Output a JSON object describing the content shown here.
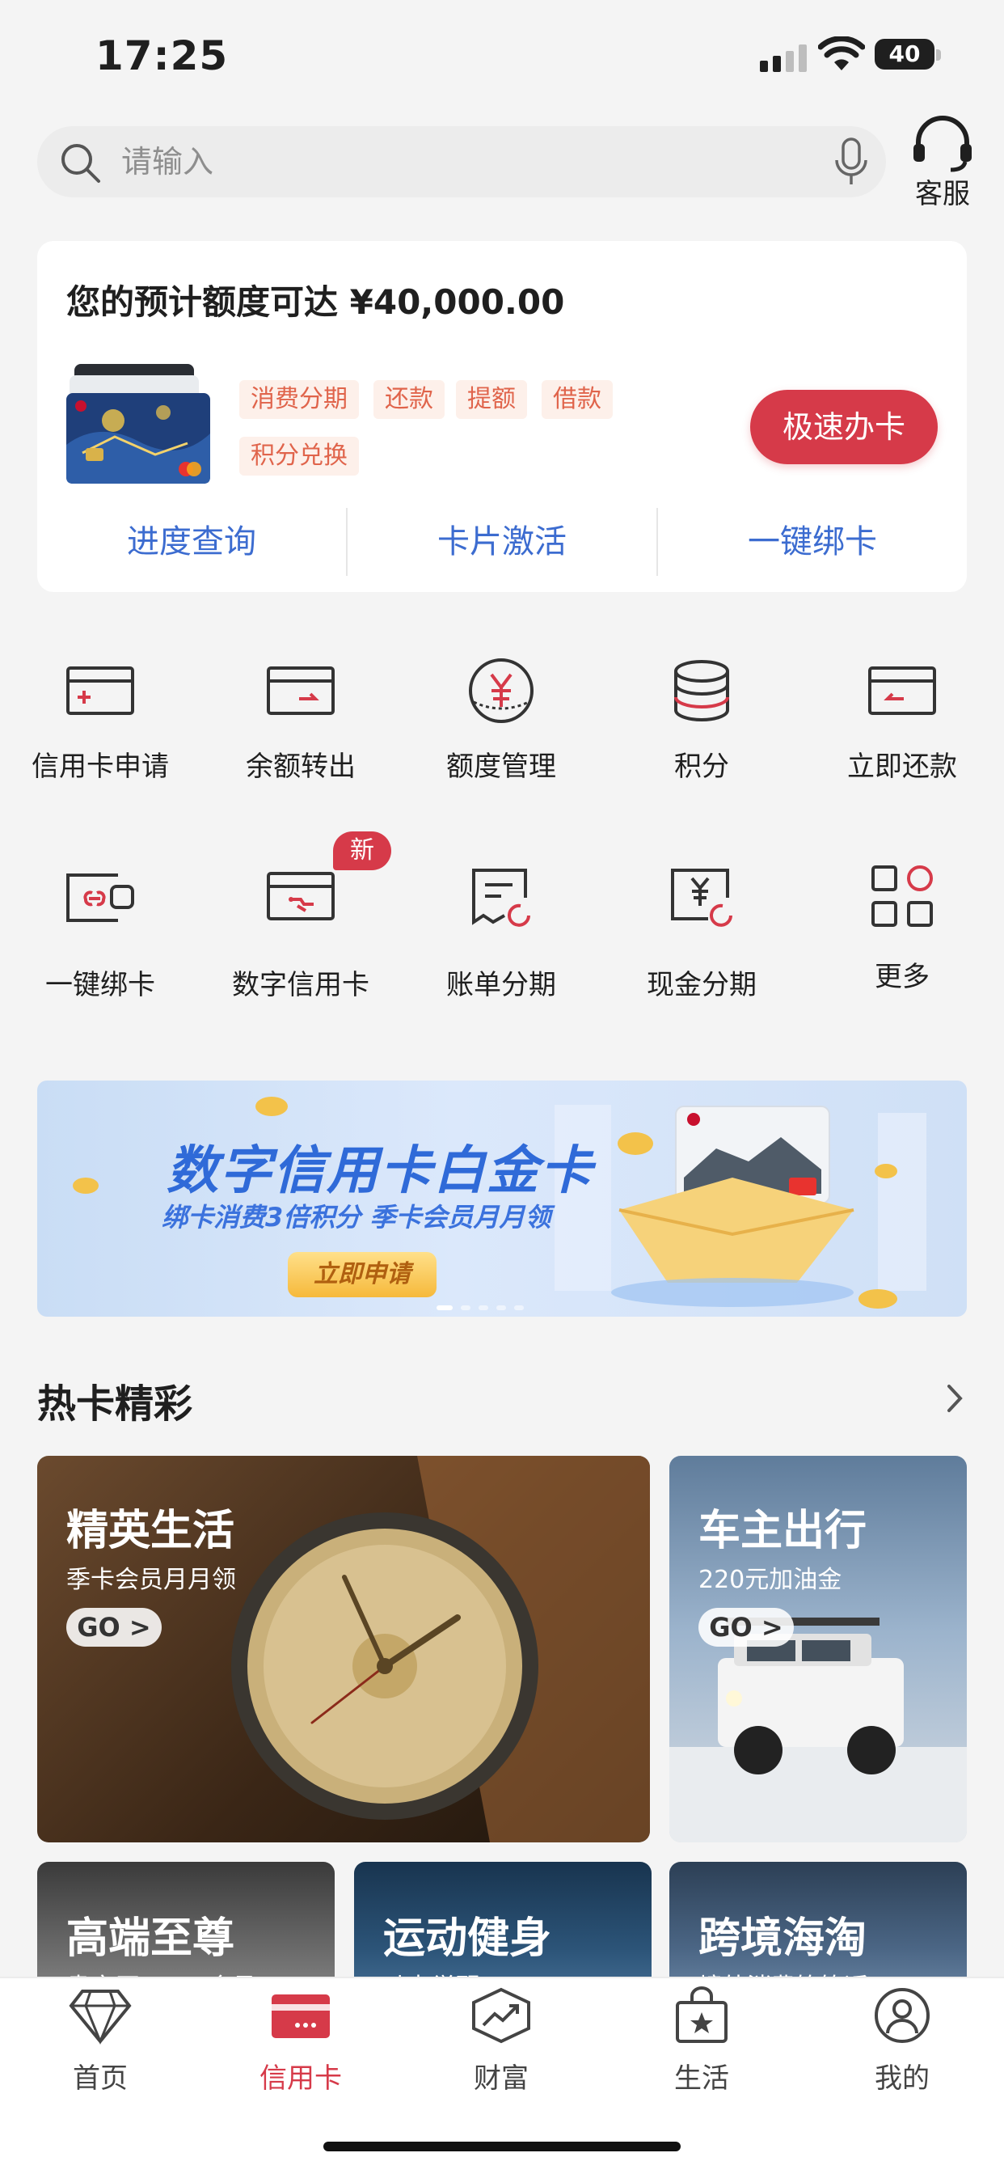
{
  "status_bar": {
    "time": "17:25",
    "battery": "40"
  },
  "search": {
    "placeholder": "请输入",
    "value": ""
  },
  "customer_service": {
    "label": "客服"
  },
  "card_panel": {
    "limit_text": "您的预计额度可达 ¥40,000.00",
    "tags": [
      "消费分期",
      "还款",
      "提额",
      "借款",
      "积分兑换"
    ],
    "apply_button": "极速办卡",
    "quick_links": [
      "进度查询",
      "卡片激活",
      "一键绑卡"
    ]
  },
  "features": [
    {
      "label": "信用卡申请",
      "icon": "card-apply-icon"
    },
    {
      "label": "余额转出",
      "icon": "balance-transfer-icon"
    },
    {
      "label": "额度管理",
      "icon": "limit-management-icon"
    },
    {
      "label": "积分",
      "icon": "points-icon"
    },
    {
      "label": "立即还款",
      "icon": "repay-now-icon"
    },
    {
      "label": "一键绑卡",
      "icon": "bind-card-icon"
    },
    {
      "label": "数字信用卡",
      "icon": "digital-card-icon",
      "badge": "新"
    },
    {
      "label": "账单分期",
      "icon": "bill-installment-icon"
    },
    {
      "label": "现金分期",
      "icon": "cash-installment-icon"
    },
    {
      "label": "更多",
      "icon": "more-grid-icon"
    }
  ],
  "banner": {
    "title": "数字信用卡白金卡",
    "subtitle": "绑卡消费3倍积分  季卡会员月月领",
    "button": "立即申请"
  },
  "hot_cards": {
    "title": "热卡精彩",
    "items": [
      {
        "title": "精英生活",
        "subtitle": "季卡会员月月领",
        "button": "GO >"
      },
      {
        "title": "车主出行",
        "subtitle": "220元加油金",
        "button": "GO >"
      },
      {
        "title": "高端至尊",
        "subtitle": "贵宾厅 · APP会员"
      },
      {
        "title": "运动健身",
        "subtitle": "动力觉醒"
      },
      {
        "title": "跨境海淘",
        "subtitle": "境外消费笔笔返"
      }
    ]
  },
  "tab_bar": {
    "active": "信用卡",
    "items": [
      "首页",
      "信用卡",
      "财富",
      "生活",
      "我的"
    ]
  },
  "colors": {
    "accent_red": "#d63a49",
    "link_blue": "#3c6cd0",
    "tag_text": "#e0644b",
    "tag_bg": "#fdf0ea"
  }
}
